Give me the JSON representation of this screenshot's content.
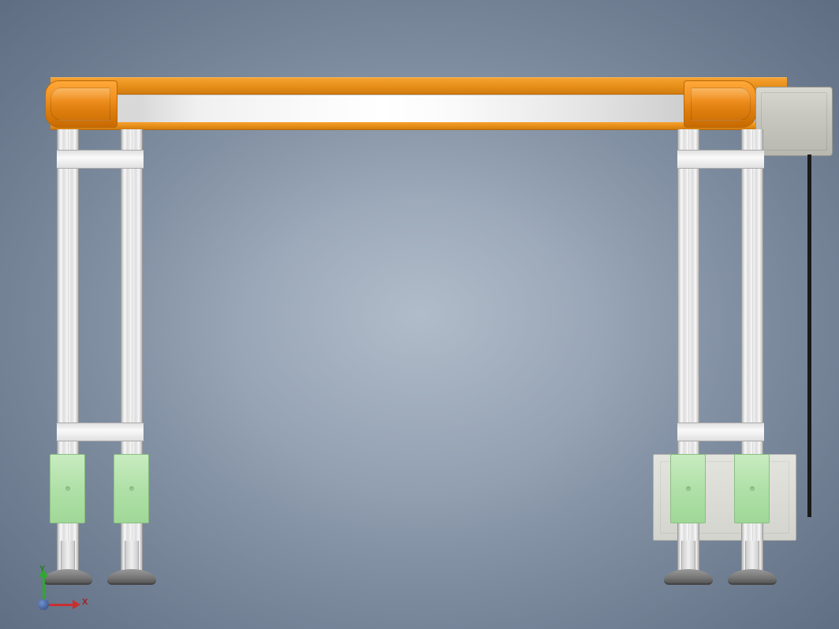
{
  "triad": {
    "x_label": "X",
    "y_label": "Y"
  },
  "colors": {
    "rail_orange": "#f09020",
    "bracket_green": "#b0e0a8",
    "motor_grey": "#c8c8c0",
    "aluminum": "#f0f0f0",
    "foot_grey": "#777777"
  }
}
